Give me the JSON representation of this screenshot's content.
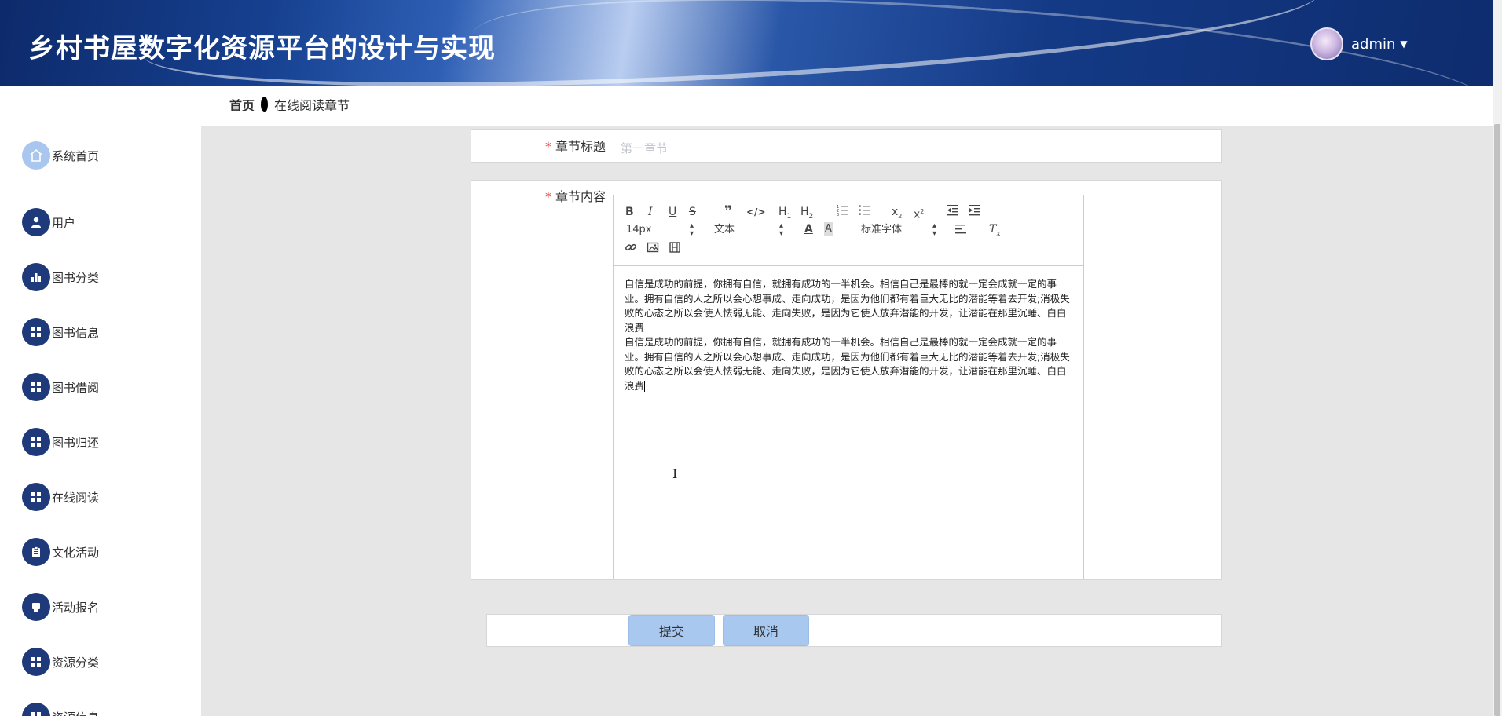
{
  "header": {
    "title": "乡村书屋数字化资源平台的设计与实现",
    "username": "admin"
  },
  "breadcrumb": {
    "home": "首页",
    "current": "在线阅读章节"
  },
  "sidebar": {
    "items": [
      {
        "label": "系统首页",
        "icon": "home-icon"
      },
      {
        "label": "用户",
        "icon": "user-icon"
      },
      {
        "label": "图书分类",
        "icon": "bar-chart-icon"
      },
      {
        "label": "图书信息",
        "icon": "grid-icon"
      },
      {
        "label": "图书借阅",
        "icon": "grid-icon"
      },
      {
        "label": "图书归还",
        "icon": "grid-icon"
      },
      {
        "label": "在线阅读",
        "icon": "grid-icon"
      },
      {
        "label": "文化活动",
        "icon": "clipboard-icon"
      },
      {
        "label": "活动报名",
        "icon": "printer-icon"
      },
      {
        "label": "资源分类",
        "icon": "grid-icon"
      },
      {
        "label": "资源信息",
        "icon": "grid-icon"
      }
    ]
  },
  "form": {
    "title_label": "章节标题",
    "title_placeholder": "第一章节",
    "content_label": "章节内容",
    "required_mark": "*",
    "editor": {
      "font_size": "14px",
      "header_picker": "文本",
      "font_picker": "标准字体",
      "paragraphs": [
        "自信是成功的前提，你拥有自信，就拥有成功的一半机会。相信自己是最棒的就一定会成就一定的事业。拥有自信的人之所以会心想事成、走向成功，是因为他们都有着巨大无比的潜能等着去开发;消极失败的心态之所以会使人怯弱无能、走向失败，是因为它使人放弃潜能的开发，让潜能在那里沉睡、白白浪费",
        "自信是成功的前提，你拥有自信，就拥有成功的一半机会。相信自己是最棒的就一定会成就一定的事业。拥有自信的人之所以会心想事成、走向成功，是因为他们都有着巨大无比的潜能等着去开发;消极失败的心态之所以会使人怯弱无能、走向失败，是因为它使人放弃潜能的开发，让潜能在那里沉睡、白白浪费"
      ]
    },
    "submit_label": "提交",
    "cancel_label": "取消"
  },
  "colors": {
    "sidebar_icon": "#1e3a7a",
    "home_icon": "#a8c6ee",
    "button": "#a8c8f0",
    "required": "#e54545",
    "page_bg": "#e6e6e6"
  }
}
